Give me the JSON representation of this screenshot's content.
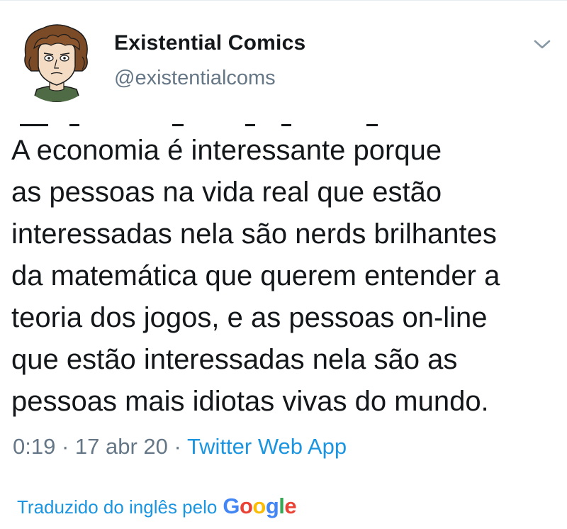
{
  "tweet": {
    "display_name": "Existential Comics",
    "handle": "@existentialcoms",
    "text_lines": [
      "A economia é interessante porque",
      "as pessoas na vida real que estão",
      "interessadas nela são nerds brilhantes",
      "da matemática que querem entender a",
      "teoria dos jogos, e as pessoas on-line",
      "que estão interessadas nela são as",
      "pessoas mais idiotas vivas do mundo."
    ],
    "time": "0:19",
    "separator": "·",
    "date": "17 abr 20",
    "source": "Twitter Web App"
  },
  "translation": {
    "label": "Traduzido do inglês pelo",
    "brand_letters": [
      "G",
      "o",
      "o",
      "g",
      "l",
      "e"
    ]
  },
  "icons": {
    "menu": "chevron-down-icon",
    "avatar": "cartoon-portrait-avatar"
  },
  "colors": {
    "text": "#14171a",
    "secondary": "#657786",
    "link": "#1b95e0"
  }
}
